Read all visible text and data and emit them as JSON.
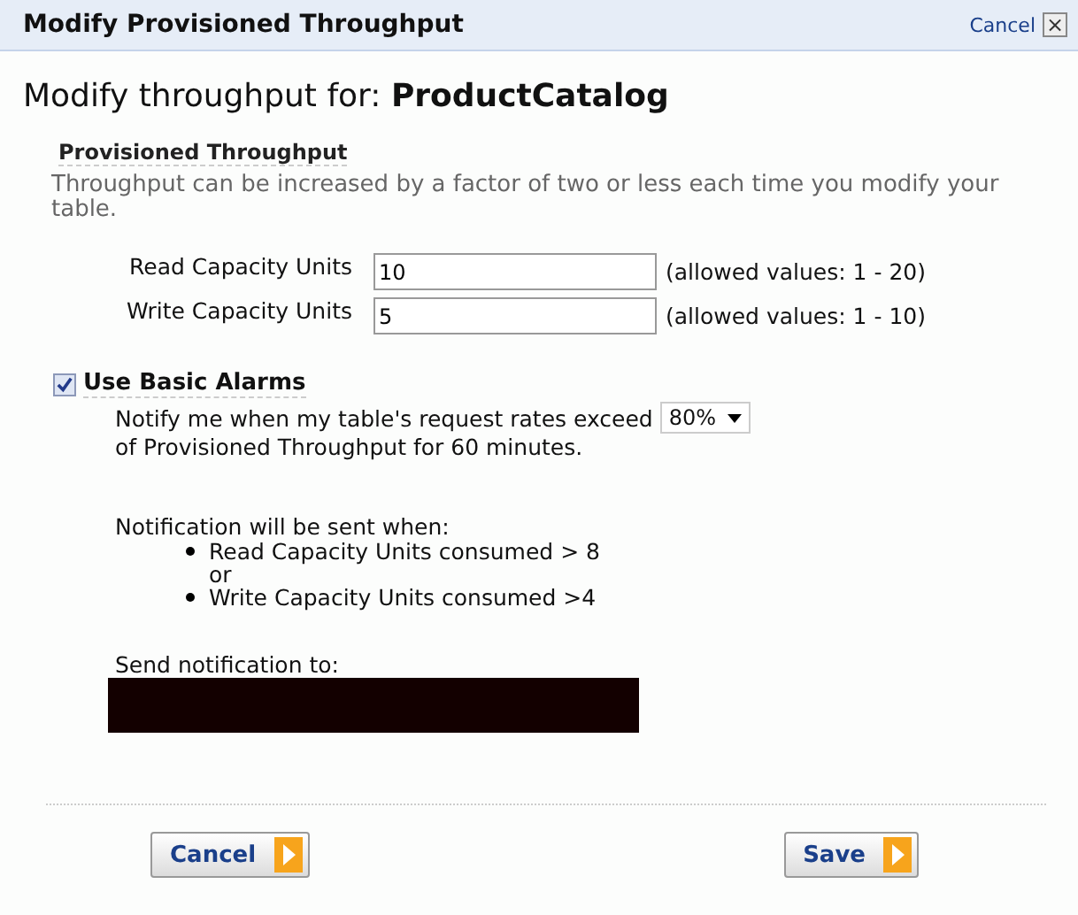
{
  "window": {
    "title": "Modify Provisioned Throughput",
    "cancel_link": "Cancel",
    "close_glyph": "×"
  },
  "heading": {
    "prefix": "Modify throughput for:",
    "table": "ProductCatalog"
  },
  "section": {
    "title": "Provisioned Throughput",
    "note": "Throughput can be increased by a factor of two or less each time you modify your table."
  },
  "fields": [
    {
      "label": "Read Capacity Units",
      "value": "10",
      "hint": "(allowed values: 1 - 20)"
    },
    {
      "label": "Write Capacity Units",
      "value": "5",
      "hint": "(allowed values: 1 - 10)"
    }
  ],
  "alarms": {
    "label": "Use Basic Alarms",
    "checked": true,
    "notify_before": "Notify me when my table's request rates exceed",
    "threshold": "80%",
    "notify_after": "of Provisioned Throughput for 60 minutes.",
    "conditions_title": "Notification will be sent when:",
    "conditions": [
      {
        "kind": "bullet",
        "text": "Read Capacity Units consumed > 8"
      },
      {
        "kind": "plain",
        "text": "or"
      },
      {
        "kind": "bullet",
        "text": "Write Capacity Units consumed >4"
      }
    ],
    "send_to": "Send notification to:"
  },
  "buttons": [
    {
      "label": "Cancel"
    },
    {
      "label": "Save"
    }
  ]
}
